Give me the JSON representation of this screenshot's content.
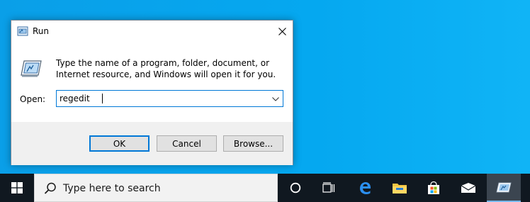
{
  "dialog": {
    "title": "Run",
    "description": "Type the name of a program, folder, document, or Internet resource, and Windows will open it for you.",
    "open_label": "Open:",
    "open_value": "regedit",
    "buttons": {
      "ok": "OK",
      "cancel": "Cancel",
      "browse": "Browse..."
    }
  },
  "taskbar": {
    "search_placeholder": "Type here to search",
    "icons": [
      "windows-start-icon",
      "search-icon",
      "cortana-icon",
      "task-view-icon",
      "edge-icon",
      "file-explorer-icon",
      "store-icon",
      "mail-icon",
      "run-app-icon"
    ]
  },
  "colors": {
    "desktop": "#00a2ed",
    "accent": "#0078d7",
    "taskbar": "#101820"
  }
}
